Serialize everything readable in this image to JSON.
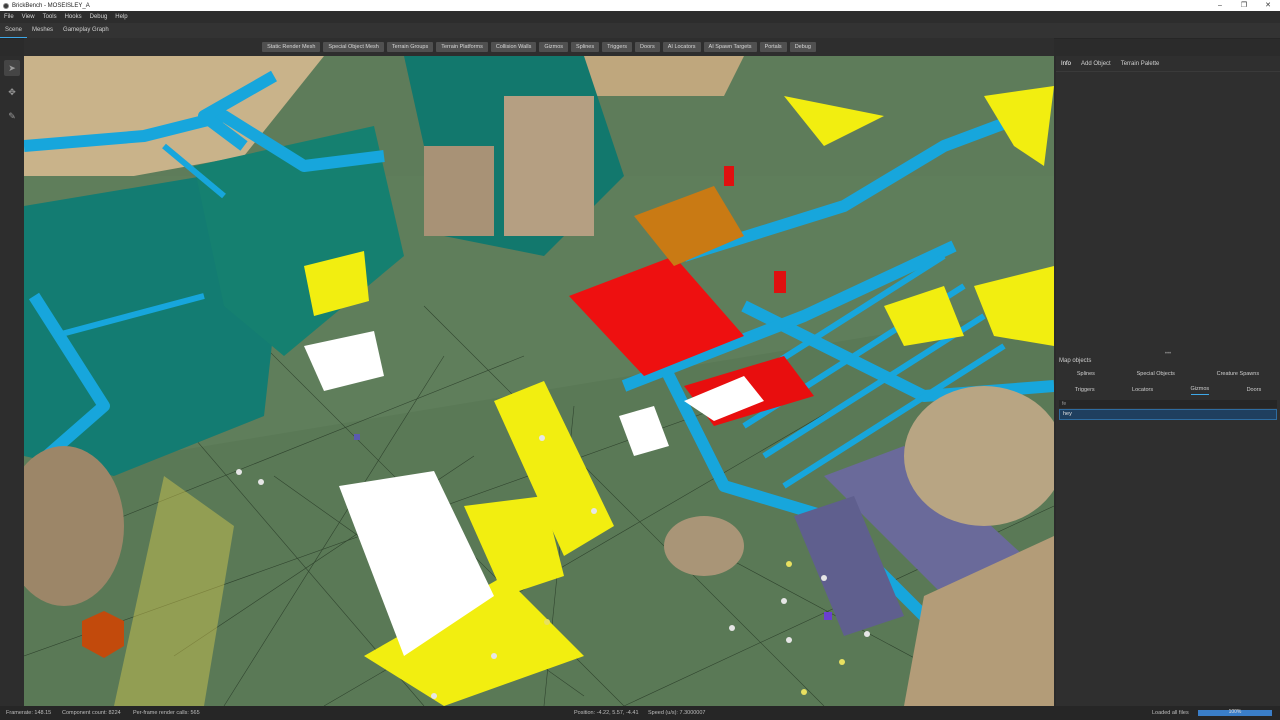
{
  "window": {
    "title": "BrickBench - MOSEISLEY_A",
    "controls": [
      "–",
      "❐",
      "✕"
    ]
  },
  "menu": [
    "File",
    "View",
    "Tools",
    "Hooks",
    "Debug",
    "Help"
  ],
  "modes": [
    {
      "label": "Scene",
      "active": true
    },
    {
      "label": "Meshes",
      "active": false
    },
    {
      "label": "Gameplay Graph",
      "active": false
    }
  ],
  "viewport_toolbar": [
    "Static Render Mesh",
    "Special Object Mesh",
    "Terrain Groups",
    "Terrain Platforms",
    "Collision Walls",
    "Gizmos",
    "Splines",
    "Triggers",
    "Doors",
    "AI Locators",
    "AI Spawn Targets",
    "Portals",
    "Debug"
  ],
  "left_tools": [
    {
      "icon": "cursor-icon",
      "active": true
    },
    {
      "icon": "move-icon",
      "active": false
    },
    {
      "icon": "paint-icon",
      "active": false
    }
  ],
  "right_panel": {
    "tabs": [
      {
        "label": "Info",
        "active": true
      },
      {
        "label": "Add Object",
        "active": false
      },
      {
        "label": "Terrain Palette",
        "active": false
      }
    ],
    "map_objects": {
      "title": "Map objects",
      "row1": [
        "Splines",
        "Special Objects",
        "Creature Spawns"
      ],
      "row2": [
        "Triggers",
        "Locators",
        "Gizmos",
        "Doors"
      ],
      "active_tab": "Gizmos",
      "filter": "fe",
      "selected_item": "hey"
    }
  },
  "status": {
    "framerate": "Framerate: 148.15",
    "component_count": "Component count: 8224",
    "render_calls": "Per-frame render calls: 565",
    "position": "Position: -4.22, 5.57, -4.41",
    "speed": "Speed (u/s): 7.3000007",
    "loaded": "Loaded all files",
    "progress": 1.0,
    "progress_label": "100%"
  },
  "colors": {
    "accent": "#3ea8e8",
    "terrain": "#5e7c5a",
    "collision": "#17a6dc",
    "platform": "#137c72",
    "highlight": "#f2ee10",
    "alert": "#ee1010"
  }
}
